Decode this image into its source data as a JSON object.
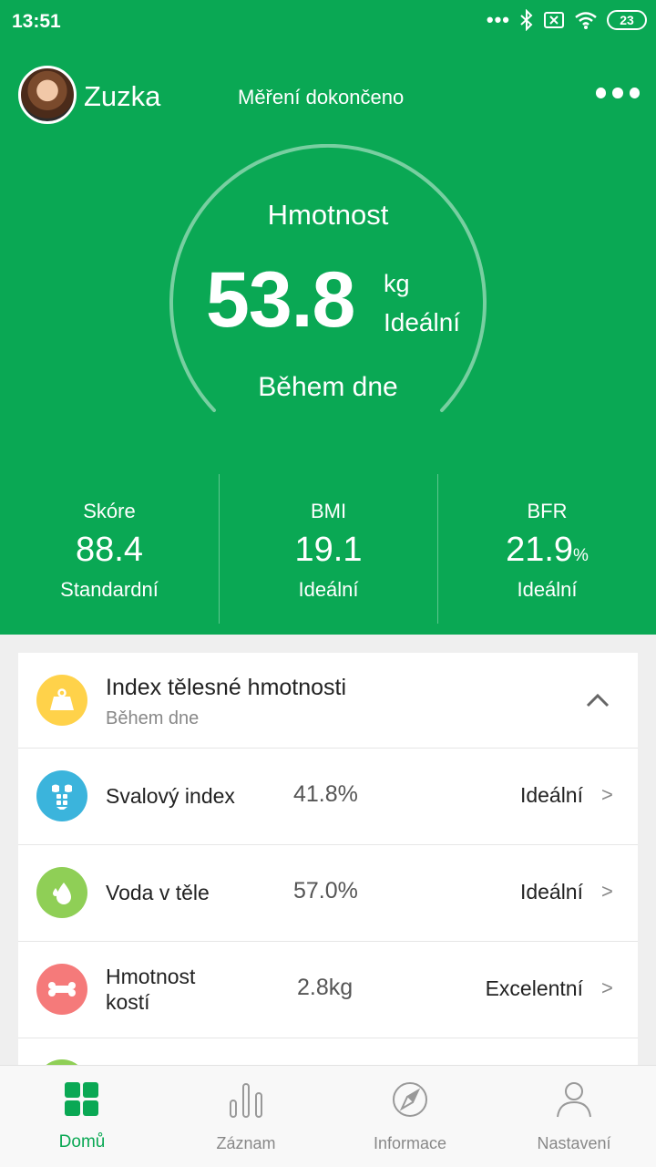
{
  "status_bar": {
    "time": "13:51",
    "dots": "•••",
    "battery": "23"
  },
  "header": {
    "user_name": "Zuzka",
    "title": "Měření dokončeno"
  },
  "weight": {
    "label": "Hmotnost",
    "value": "53.8",
    "unit": "kg",
    "status": "Ideální",
    "time_of_day": "Během dne"
  },
  "stats": [
    {
      "label": "Skóre",
      "value": "88.4",
      "unit": "",
      "status": "Standardní"
    },
    {
      "label": "BMI",
      "value": "19.1",
      "unit": "",
      "status": "Ideální"
    },
    {
      "label": "BFR",
      "value": "21.9",
      "unit": "%",
      "status": "Ideální"
    }
  ],
  "card": {
    "title": "Index tělesné hmotnosti",
    "subtitle": "Během dne",
    "rows": [
      {
        "label": "Svalový index",
        "value": "41.8%",
        "status": "Ideální",
        "icon": "muscle-icon",
        "color": "#3bb4dc"
      },
      {
        "label": "Voda v těle",
        "value": "57.0%",
        "status": "Ideální",
        "icon": "water-drop-icon",
        "color": "#8fcf56"
      },
      {
        "label_line1": "Hmotnost",
        "label_line2": "kostí",
        "value": "2.8kg",
        "status": "Excelentní",
        "icon": "bone-icon",
        "color": "#f57a7a"
      }
    ],
    "arrow": ">"
  },
  "tabs": [
    {
      "label": "Domů",
      "icon": "home-grid-icon",
      "active": true
    },
    {
      "label": "Záznam",
      "icon": "bar-chart-icon",
      "active": false
    },
    {
      "label": "Informace",
      "icon": "compass-icon",
      "active": false
    },
    {
      "label": "Nastavení",
      "icon": "person-icon",
      "active": false
    }
  ],
  "colors": {
    "primary_green": "#0aa854",
    "yellow": "#ffd24a",
    "blue": "#3bb4dc",
    "light_green": "#8fcf56",
    "red": "#f57a7a"
  }
}
